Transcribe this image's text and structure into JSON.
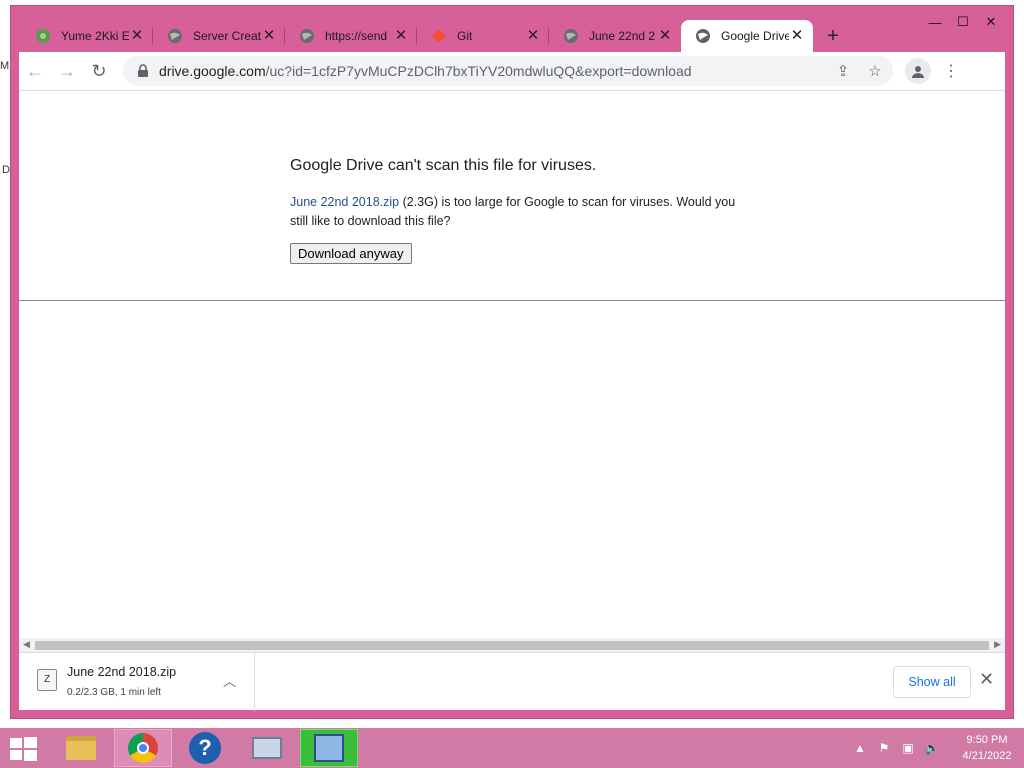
{
  "desktop": {
    "edge_letter_1": "M",
    "edge_letter_2": "D"
  },
  "window": {
    "minimize": "—",
    "maximize": "☐",
    "close": "✕"
  },
  "tabs": [
    {
      "title": "Yume 2Kki E",
      "icon": "yume-favicon",
      "close": "✕"
    },
    {
      "title": "Server Creat",
      "icon": "globe-icon",
      "close": "✕"
    },
    {
      "title": "https://send",
      "icon": "globe-icon",
      "close": "✕"
    },
    {
      "title": "Git",
      "icon": "git-icon",
      "close": "✕"
    },
    {
      "title": "June 22nd 2",
      "icon": "globe-icon",
      "close": "✕"
    },
    {
      "title": "Google Drive",
      "icon": "globe-icon",
      "close": "✕",
      "active": true
    }
  ],
  "new_tab": "+",
  "toolbar": {
    "back": "←",
    "forward": "→",
    "reload": "↻",
    "url_host": "drive.google.com",
    "url_rest": "/uc?id=1cfzP7yvMuCPzDClh7bxTiYV20mdwluQQ&export=download",
    "share": "⇪",
    "bookmark": "☆",
    "menu": "⋮"
  },
  "page": {
    "heading": "Google Drive can't scan this file for viruses.",
    "file_link": "June 22nd 2018.zip",
    "message_rest": " (2.3G) is too large for Google to scan for viruses. Would you still like to download this file?",
    "button": "Download anyway"
  },
  "download_shelf": {
    "file_name": "June 22nd 2018.zip",
    "status": "0.2/2.3 GB, 1 min left",
    "show_all": "Show all",
    "close": "✕"
  },
  "taskbar": {
    "apps": [
      "file-explorer",
      "chrome",
      "help",
      "performance-monitor",
      "installer"
    ],
    "time": "9:50 PM",
    "date": "4/21/2022"
  }
}
